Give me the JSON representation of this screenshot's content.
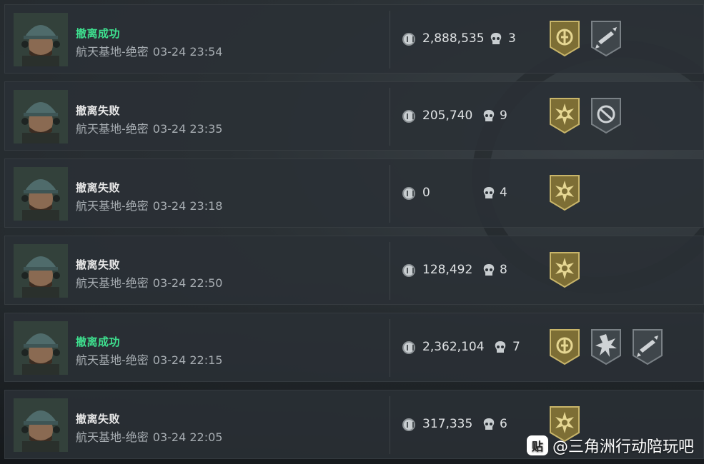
{
  "records": [
    {
      "status": "撤离成功",
      "success": true,
      "map": "航天基地-绝密",
      "time": "03-24 23:54",
      "money": "2,888,535",
      "kills": "3",
      "badges": [
        "gold-shield-badge",
        "gray-rocket-badge"
      ]
    },
    {
      "status": "撤离失败",
      "success": false,
      "map": "航天基地-绝密",
      "time": "03-24 23:35",
      "money": "205,740",
      "kills": "9",
      "badges": [
        "gold-star-badge",
        "gray-crosshair-badge"
      ]
    },
    {
      "status": "撤离失败",
      "success": false,
      "map": "航天基地-绝密",
      "time": "03-24 23:18",
      "money": "0",
      "kills": "4",
      "badges": [
        "gold-star-badge"
      ]
    },
    {
      "status": "撤离失败",
      "success": false,
      "map": "航天基地-绝密",
      "time": "03-24 22:50",
      "money": "128,492",
      "kills": "8",
      "badges": [
        "gold-star-badge"
      ]
    },
    {
      "status": "撤离成功",
      "success": true,
      "map": "航天基地-绝密",
      "time": "03-24 22:15",
      "money": "2,362,104",
      "kills": "7",
      "badges": [
        "gold-shield-badge",
        "gray-burst-badge",
        "gray-rocket-badge"
      ]
    },
    {
      "status": "撤离失败",
      "success": false,
      "map": "航天基地-绝密",
      "time": "03-24 22:05",
      "money": "317,335",
      "kills": "6",
      "badges": [
        "gold-star-badge"
      ]
    }
  ],
  "watermark": {
    "logo": "贴",
    "text": "@三角洲行动陪玩吧"
  },
  "colors": {
    "success": "#3ee08f",
    "failure": "#e8e8e8",
    "gold": "#8a7a3e",
    "gray": "#4a5156"
  }
}
